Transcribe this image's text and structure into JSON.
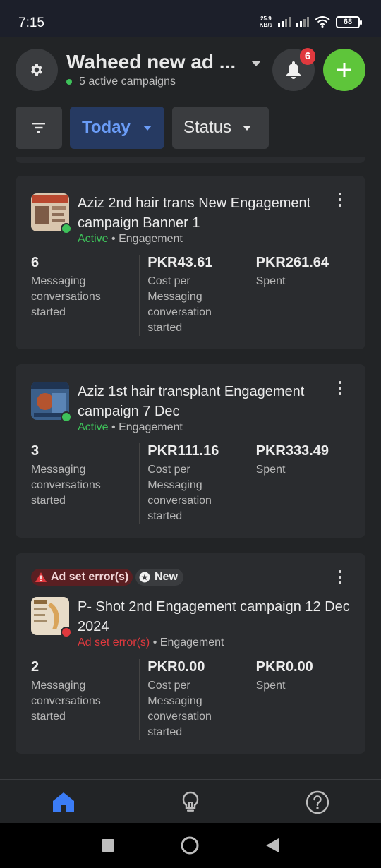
{
  "status_bar": {
    "time": "7:15",
    "net_speed": "25.9",
    "net_unit": "KB/s",
    "battery": "68"
  },
  "header": {
    "account_name": "Waheed new ad ...",
    "active_campaigns": "5 active campaigns",
    "notification_count": "6",
    "icons": [
      "gear-icon",
      "chevron-down-icon",
      "bell-icon",
      "plus-icon"
    ]
  },
  "filters": {
    "filter_icon": "filter-icon",
    "date_label": "Today",
    "status_label": "Status"
  },
  "campaigns": [
    {
      "name": "Aziz 2nd hair trans New Engagement campaign Banner 1",
      "status": "Active",
      "separator": "•",
      "objective": "Engagement",
      "metrics": [
        {
          "value": "6",
          "label": "Messaging conversations started"
        },
        {
          "value": "PKR43.61",
          "label": "Cost per Messaging conversation started"
        },
        {
          "value": "PKR261.64",
          "label": "Spent"
        }
      ]
    },
    {
      "name": "Aziz 1st hair transplant Engagement campaign 7 Dec",
      "status": "Active",
      "separator": "•",
      "objective": "Engagement",
      "metrics": [
        {
          "value": "3",
          "label": "Messaging conversations started"
        },
        {
          "value": "PKR111.16",
          "label": "Cost per Messaging conversation started"
        },
        {
          "value": "PKR333.49",
          "label": "Spent"
        }
      ]
    },
    {
      "error_pill": "Ad set error(s)",
      "new_pill": "New",
      "name": "P- Shot 2nd Engagement campaign 12 Dec 2024",
      "status": "Ad set error(s)",
      "separator": "•",
      "objective": "Engagement",
      "metrics": [
        {
          "value": "2",
          "label": "Messaging conversations started"
        },
        {
          "value": "PKR0.00",
          "label": "Cost per Messaging conversation started"
        },
        {
          "value": "PKR0.00",
          "label": "Spent"
        }
      ]
    }
  ],
  "colors": {
    "background": "#222426",
    "card": "#2a2c2f",
    "accent_blue": "#6a9cf7",
    "active_green": "#3ec25a",
    "error_red": "#e0393e",
    "add_button": "#5ec53a"
  },
  "bottom_nav": [
    "home-icon",
    "lightbulb-icon",
    "help-icon"
  ],
  "system_nav": [
    "recents-icon",
    "home-circle-icon",
    "back-icon"
  ]
}
